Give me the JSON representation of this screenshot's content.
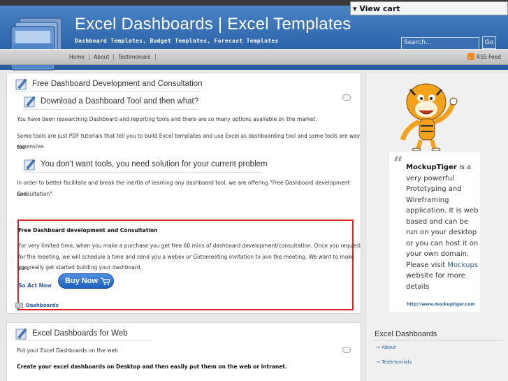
{
  "cart": {
    "label": "▾ View cart"
  },
  "header": {
    "title": "Excel Dashboards | Excel Templates",
    "tagline": "Dashboard Templates, Budget Templates, Forecast Templates",
    "search_placeholder": "Search...",
    "search_button": "Go"
  },
  "nav": {
    "items": [
      {
        "label": "Home"
      },
      {
        "label": "About"
      },
      {
        "label": "Testimonials"
      }
    ],
    "rss_label": "RSS Feed"
  },
  "post1": {
    "title": "Free Dashboard Development and Consultation",
    "subtitle1": "Download a Dashboard Tool and then what?",
    "para1": "You have been researching Dashboard and reporting tools and there are so many options available on the market.",
    "para2_line1": "Some tools are just PDF tutorials that tell you to build Excel templates and use Excel as dashboarding tool and some tools are way too",
    "para2_line2": "expensive.",
    "subtitle2": "You don't want tools, you need solution for your current problem",
    "para3_line1": "In order to better facilitate and break the inertia of learning any dashboard tool, we are offering \"Free Dashboard development and",
    "para3_line2": "Consultation\"",
    "promo": {
      "heading": "Free Dashboard development and Consultation",
      "line1": "For very limited time, when you make a purchase you get free 60 mins of dashboard development/consultation. Once you request",
      "line2": "for the meeting, we will schedule a time and send you a webex or Gotomeeting invitation to join the meeting. We want to make sure",
      "line3": "you really get started building your dashboard.",
      "act_now": "So Act Now",
      "buy_now": "Buy Now"
    },
    "category": "Dashboards"
  },
  "post2": {
    "title": "Excel Dashboards for Web",
    "para1": "Put your Excel Dashboards on the web",
    "para2": "Create your excel dashboards on Desktop and then easily put them on the web or intranet."
  },
  "sidebar": {
    "quote": {
      "brand": "MockupTiger",
      "text_after": " is a very powerful Prototyping and Wireframing application. It is web based and can be run on your desktop or you can host it on your own domain. Please visit ",
      "link": "Mockups",
      "text_end": " website for more details",
      "url": "http://www.mockuptiger.com"
    },
    "heading": "Excel Dashboards",
    "links": [
      {
        "label": "About"
      },
      {
        "label": "Testimonials"
      }
    ]
  }
}
